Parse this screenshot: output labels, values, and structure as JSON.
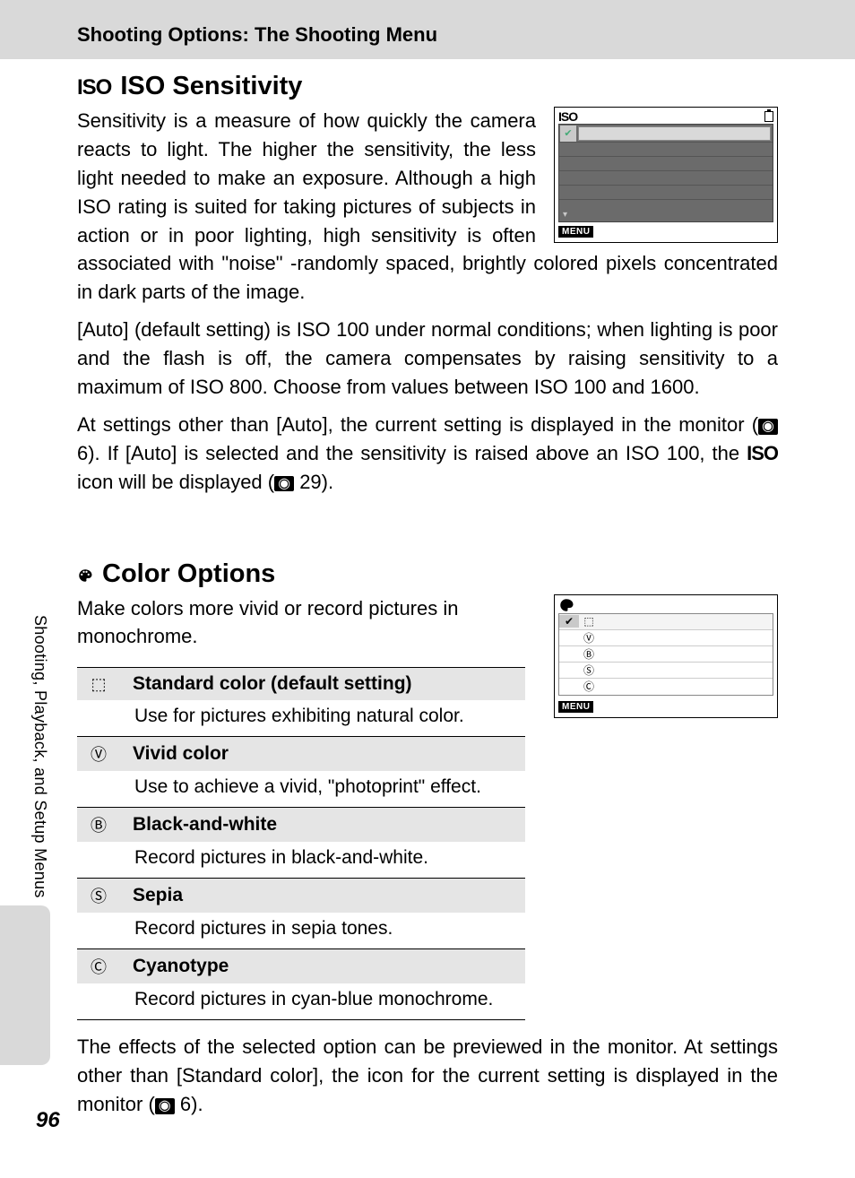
{
  "header": {
    "breadcrumb": "Shooting Options: The Shooting Menu"
  },
  "sidebar": {
    "label": "Shooting, Playback, and Setup Menus"
  },
  "pageNumber": "96",
  "iso": {
    "icon": "ISO",
    "title": "ISO Sensitivity",
    "para1a": "Sensitivity is a measure of how quickly the camera reacts to light. The higher the sensitivity, the less light needed to make an exposure. Although a high ISO rating is suited for taking pictures of subjects in action or in poor lighting, high sensitivity is often",
    "para1b": "associated with \"noise\" -randomly spaced, brightly colored pixels concentrated in dark parts of the image.",
    "para2": "[Auto] (default setting) is ISO 100 under normal conditions; when lighting is poor and the flash is off, the camera compensates by raising sensitivity to a maximum of ISO 800. Choose from values between ISO 100 and 1600.",
    "para3a": "At settings other than [Auto], the current setting is displayed in the monitor (",
    "para3b": " 6). If [Auto] is selected and the sensitivity is raised above an ISO 100, the ",
    "para3c": " icon will be displayed (",
    "para3d": " 29).",
    "isoInline": "ISO",
    "screenshot": {
      "topLabel": "ISO",
      "menu": "MENU"
    }
  },
  "color": {
    "title": "Color Options",
    "intro": "Make colors more vivid or record pictures in monochrome.",
    "options": [
      {
        "name": "Standard color (default setting)",
        "desc": "Use for pictures exhibiting natural color.",
        "iconKey": "standard"
      },
      {
        "name": "Vivid color",
        "desc": "Use to achieve a vivid, \"photoprint\" effect.",
        "iconKey": "vivid"
      },
      {
        "name": "Black-and-white",
        "desc": "Record pictures in black-and-white.",
        "iconKey": "bw"
      },
      {
        "name": "Sepia",
        "desc": "Record pictures in sepia tones.",
        "iconKey": "sepia"
      },
      {
        "name": "Cyanotype",
        "desc": "Record pictures in cyan-blue monochrome.",
        "iconKey": "cyan"
      }
    ],
    "footer_a": "The effects of the selected option can be previewed in the monitor. At settings other than [Standard color], the icon for the current setting is displayed in the monitor (",
    "footer_b": " 6).",
    "screenshot": {
      "menu": "MENU"
    }
  },
  "refIcon": "⯐"
}
